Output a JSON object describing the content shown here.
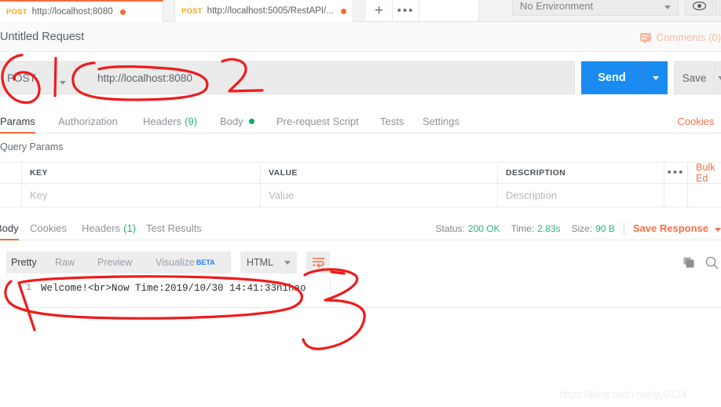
{
  "window": {
    "tabs": [
      {
        "method": "POST",
        "url": "http://localhost:8080",
        "unsaved": true,
        "active": true
      },
      {
        "method": "POST",
        "url": "http://localhost:5005/RestAPI/...",
        "unsaved": true,
        "active": false
      }
    ],
    "new_tab_label": "+",
    "tab_more_label": "•••",
    "environment": {
      "selected": "No Environment"
    }
  },
  "request": {
    "title": "Untitled Request",
    "comments_label": "Comments (0)",
    "method": "POST",
    "url": "http://localhost:8080",
    "send_label": "Send",
    "save_label": "Save",
    "tabs": [
      {
        "label": "Params",
        "active": true
      },
      {
        "label": "Authorization",
        "active": false
      },
      {
        "label": "Headers",
        "count": "(9)",
        "active": false
      },
      {
        "label": "Body",
        "dot": true,
        "active": false
      },
      {
        "label": "Pre-request Script",
        "active": false
      },
      {
        "label": "Tests",
        "active": false
      },
      {
        "label": "Settings",
        "active": false
      }
    ],
    "right_links": [
      "Cookies",
      "Co"
    ]
  },
  "query_params": {
    "section_label": "Query Params",
    "columns": [
      "KEY",
      "VALUE",
      "DESCRIPTION"
    ],
    "more_label": "•••",
    "bulk_edit_label": "Bulk Ed",
    "rows": [
      {
        "key_placeholder": "Key",
        "value_placeholder": "Value",
        "description_placeholder": "Description"
      }
    ]
  },
  "response": {
    "tabs": [
      {
        "label": "Body",
        "active": true
      },
      {
        "label": "Cookies",
        "active": false
      },
      {
        "label": "Headers",
        "count": "(1)",
        "active": false
      },
      {
        "label": "Test Results",
        "active": false
      }
    ],
    "status_label": "Status:",
    "status_value": "200 OK",
    "time_label": "Time:",
    "time_value": "2.83s",
    "size_label": "Size:",
    "size_value": "90 B",
    "save_response_label": "Save Response",
    "view_tabs": [
      {
        "label": "Pretty",
        "active": true
      },
      {
        "label": "Raw",
        "active": false
      },
      {
        "label": "Preview",
        "active": false
      },
      {
        "label": "Visualize",
        "badge": "BETA",
        "active": false
      }
    ],
    "format_selected": "HTML",
    "body_lines": [
      {
        "number": "1",
        "text": "Welcome!<br>Now Time:2019/10/30 14:41:33nihao"
      }
    ]
  },
  "annotations": {
    "markup_color": "#ee1c1c",
    "numbers": [
      "1",
      "2",
      "3"
    ]
  },
  "watermark": "https://blog.csdn.net/gy0124",
  "colors": {
    "accent_orange": "#f26b3a",
    "send_blue": "#1a8cf1",
    "status_green": "#2bb673",
    "method_orange": "#f5a623",
    "beta_blue": "#2f7ff0"
  }
}
